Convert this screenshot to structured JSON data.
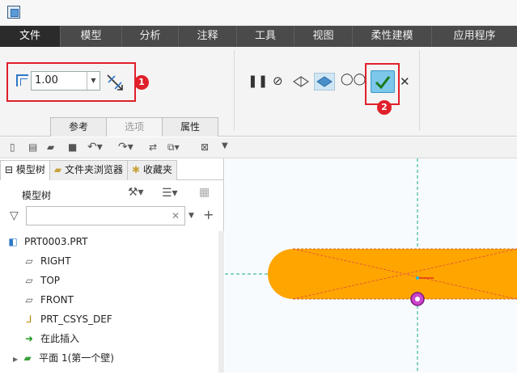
{
  "menu": [
    "文件",
    "模型",
    "分析",
    "注释",
    "工具",
    "视图",
    "柔性建模",
    "应用程序"
  ],
  "ribbon": {
    "thickness_value": "1.00",
    "badge1": "1",
    "badge2": "2",
    "tabs": [
      "参考",
      "选项",
      "属性"
    ]
  },
  "panel_tabs": [
    "模型树",
    "文件夹浏览器",
    "收藏夹"
  ],
  "tree_title": "模型树",
  "tree_items": [
    "PRT0003.PRT",
    "RIGHT",
    "TOP",
    "FRONT",
    "PRT_CSYS_DEF",
    "在此插入",
    "平面 1(第一个壁)"
  ],
  "colors": {
    "accent": "#ffa500",
    "menubar": "#4a4a4a",
    "highlight": "#e0202a",
    "ok": "#7dc7ea"
  }
}
